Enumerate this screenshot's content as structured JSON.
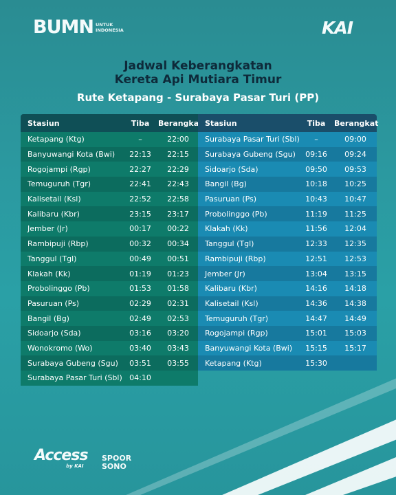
{
  "header": {
    "bumn_logo": "BUMN",
    "bumn_tagline_1": "UNTUK",
    "bumn_tagline_2": "INDONESIA",
    "kai_logo": "KAI"
  },
  "title": {
    "line1": "Jadwal Keberangkatan",
    "line2": "Kereta Api  Mutiara Timur",
    "route": "Rute Ketapang - Surabaya Pasar Turi (PP)"
  },
  "left_table": {
    "headers": {
      "station": "Stasiun",
      "arrive": "Tiba",
      "depart": "Berangkat"
    },
    "rows": [
      {
        "station": "Ketapang (Ktg)",
        "arrive": "–",
        "depart": "22:00"
      },
      {
        "station": "Banyuwangi Kota (Bwi)",
        "arrive": "22:13",
        "depart": "22:15"
      },
      {
        "station": "Rogojampi (Rgp)",
        "arrive": "22:27",
        "depart": "22:29"
      },
      {
        "station": "Temuguruh (Tgr)",
        "arrive": "22:41",
        "depart": "22:43"
      },
      {
        "station": "Kalisetail (Ksl)",
        "arrive": "22:52",
        "depart": "22:58"
      },
      {
        "station": "Kalibaru (Kbr)",
        "arrive": "23:15",
        "depart": "23:17"
      },
      {
        "station": "Jember (Jr)",
        "arrive": "00:17",
        "depart": "00:22"
      },
      {
        "station": "Rambipuji (Rbp)",
        "arrive": "00:32",
        "depart": "00:34"
      },
      {
        "station": "Tanggul (Tgl)",
        "arrive": "00:49",
        "depart": "00:51"
      },
      {
        "station": "Klakah (Kk)",
        "arrive": "01:19",
        "depart": "01:23"
      },
      {
        "station": "Probolinggo (Pb)",
        "arrive": "01:53",
        "depart": "01:58"
      },
      {
        "station": "Pasuruan (Ps)",
        "arrive": "02:29",
        "depart": "02:31"
      },
      {
        "station": "Bangil (Bg)",
        "arrive": "02:49",
        "depart": "02:53"
      },
      {
        "station": "Sidoarjo (Sda)",
        "arrive": "03:16",
        "depart": "03:20"
      },
      {
        "station": "Wonokromo (Wo)",
        "arrive": "03:40",
        "depart": "03:43"
      },
      {
        "station": "Surabaya Gubeng (Sgu)",
        "arrive": "03:51",
        "depart": "03:55"
      },
      {
        "station": "Surabaya Pasar Turi (Sbl)",
        "arrive": "04:10",
        "depart": ""
      }
    ]
  },
  "right_table": {
    "headers": {
      "station": "Stasiun",
      "arrive": "Tiba",
      "depart": "Berangkat"
    },
    "rows": [
      {
        "station": "Surabaya Pasar Turi (Sbl)",
        "arrive": "–",
        "depart": "09:00"
      },
      {
        "station": "Surabaya Gubeng (Sgu)",
        "arrive": "09:16",
        "depart": "09:24"
      },
      {
        "station": "Sidoarjo (Sda)",
        "arrive": "09:50",
        "depart": "09:53"
      },
      {
        "station": "Bangil (Bg)",
        "arrive": "10:18",
        "depart": "10:25"
      },
      {
        "station": "Pasuruan (Ps)",
        "arrive": "10:43",
        "depart": "10:47"
      },
      {
        "station": "Probolinggo (Pb)",
        "arrive": "11:19",
        "depart": "11:25"
      },
      {
        "station": "Klakah (Kk)",
        "arrive": "11:56",
        "depart": "12:04"
      },
      {
        "station": "Tanggul (Tgl)",
        "arrive": "12:33",
        "depart": "12:35"
      },
      {
        "station": "Rambipuji (Rbp)",
        "arrive": "12:51",
        "depart": "12:53"
      },
      {
        "station": "Jember (Jr)",
        "arrive": "13:04",
        "depart": "13:15"
      },
      {
        "station": "Kalibaru (Kbr)",
        "arrive": "14:16",
        "depart": "14:18"
      },
      {
        "station": "Kalisetail (Ksl)",
        "arrive": "14:36",
        "depart": "14:38"
      },
      {
        "station": "Temuguruh (Tgr)",
        "arrive": "14:47",
        "depart": "14:49"
      },
      {
        "station": "Rogojampi (Rgp)",
        "arrive": "15:01",
        "depart": "15:03"
      },
      {
        "station": "Banyuwangi Kota (Bwi)",
        "arrive": "15:15",
        "depart": "15:17"
      },
      {
        "station": "Ketapang (Ktg)",
        "arrive": "15:30",
        "depart": ""
      }
    ]
  },
  "footer": {
    "access_logo": "Access",
    "access_by": "by KAI",
    "spoor_line1": "SPOOR",
    "spoor_line2": "SONO"
  },
  "colors": {
    "background": "#2a9aa0",
    "left_header": "#0f4f56",
    "left_row": "#0e7b6a",
    "right_header": "#1a4e6a",
    "right_row": "#1a8bb3",
    "title_dark": "#0e2a3a"
  }
}
